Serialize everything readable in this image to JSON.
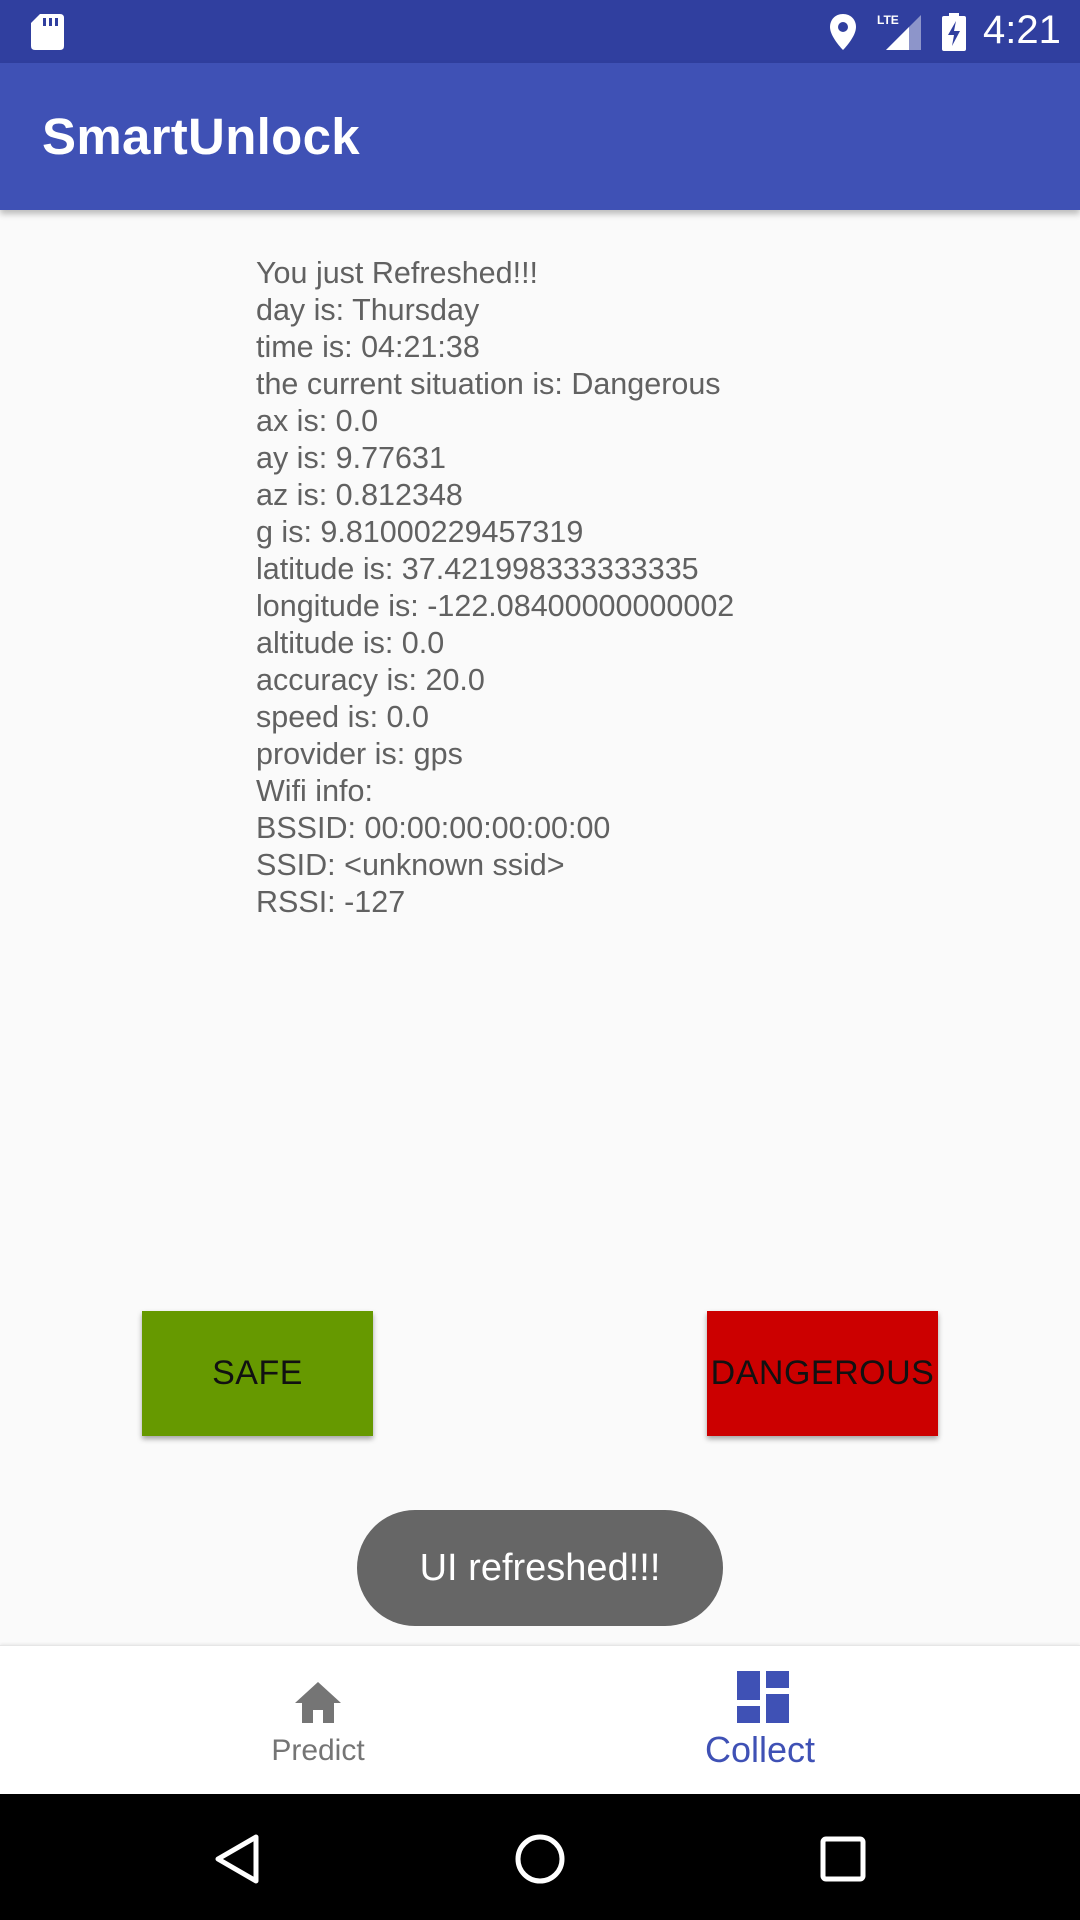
{
  "status_bar": {
    "time": "4:21",
    "network_label": "LTE",
    "icons": [
      "sd-card-icon",
      "location-icon",
      "signal-icon",
      "battery-charging-icon"
    ]
  },
  "app_bar": {
    "title": "SmartUnlock"
  },
  "info": {
    "lines": [
      "You just Refreshed!!!",
      "day is: Thursday",
      "time is: 04:21:38",
      "the current situation is: Dangerous",
      "ax is: 0.0",
      "ay is: 9.77631",
      "az is: 0.812348",
      "g is: 9.81000229457319",
      "latitude is: 37.421998333333335",
      "longitude is: -122.08400000000002",
      "altitude is: 0.0",
      "accuracy is: 20.0",
      "speed is: 0.0",
      "provider is: gps",
      "Wifi info:",
      "BSSID: 00:00:00:00:00:00",
      "SSID: <unknown ssid>",
      "RSSI: -127"
    ]
  },
  "buttons": {
    "safe_label": "SAFE",
    "dangerous_label": "DANGEROUS",
    "safe_color": "#669900",
    "dangerous_color": "#cc0000"
  },
  "toast": {
    "message": "UI refreshed!!!"
  },
  "bottom_nav": {
    "items": [
      {
        "label": "Predict",
        "icon": "home-icon",
        "active": false
      },
      {
        "label": "Collect",
        "icon": "dashboard-icon",
        "active": true
      }
    ],
    "active_color": "#3f51b5",
    "inactive_color": "#757575"
  },
  "system_nav": {
    "icons": [
      "back-icon",
      "home-circle-icon",
      "recents-icon"
    ]
  },
  "colors": {
    "status_bar": "#303f9f",
    "app_bar": "#3f51b5",
    "background": "#fafafa",
    "toast": "#666666"
  }
}
